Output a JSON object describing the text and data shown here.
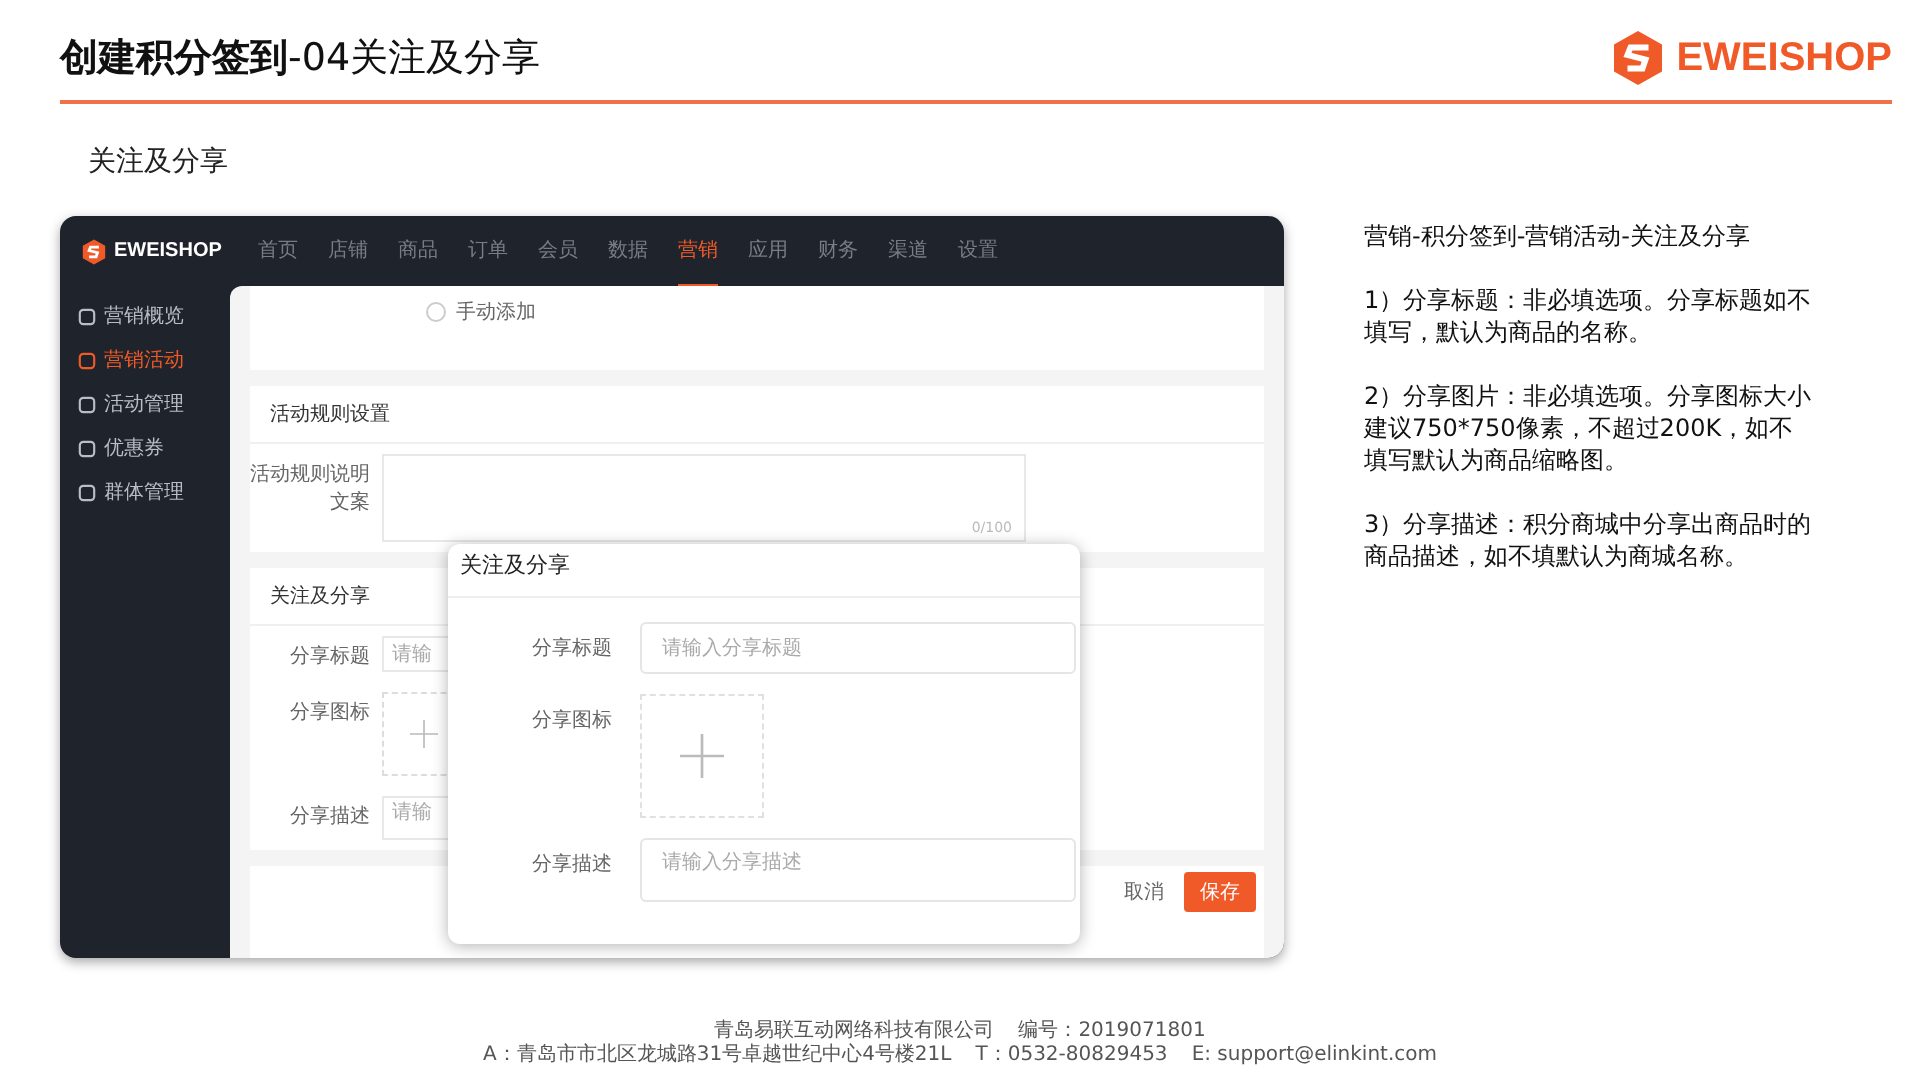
{
  "header": {
    "title": "**创建积分签到**-04关注及分享",
    "logo": "EWEISHOP"
  },
  "section_title": "关注及分享",
  "screenshot": {
    "logo": "EWEISHOP",
    "nav": [
      {
        "label": "首页",
        "selected": false
      },
      {
        "label": "店铺",
        "selected": false
      },
      {
        "label": "商品",
        "selected": false
      },
      {
        "label": "订单",
        "selected": false
      },
      {
        "label": "会员",
        "selected": false
      },
      {
        "label": "数据",
        "selected": false
      },
      {
        "label": "营销",
        "selected": true
      },
      {
        "label": "应用",
        "selected": false
      },
      {
        "label": "财务",
        "selected": false
      },
      {
        "label": "渠道",
        "selected": false
      },
      {
        "label": "设置",
        "selected": false
      }
    ],
    "sidebar": [
      {
        "label": "营销概览",
        "selected": false
      },
      {
        "label": "营销活动",
        "selected": true
      },
      {
        "label": "活动管理",
        "selected": false
      },
      {
        "label": "优惠券",
        "selected": false
      },
      {
        "label": "群体管理",
        "selected": false
      }
    ],
    "radio_option": {
      "label": "手动添加",
      "selected": false
    },
    "rules_card": {
      "title": "活动规则设置",
      "label": "活动规则说明文案",
      "counter": "0/100"
    },
    "share_card": {
      "title": "关注及分享",
      "fields": [
        {
          "label": "分享标题",
          "kind": "input",
          "placeholder": "请输"
        },
        {
          "label": "分享图标",
          "kind": "upload"
        },
        {
          "label": "分享描述",
          "kind": "textarea",
          "placeholder": "请输"
        }
      ]
    },
    "buttons": [
      {
        "label": "取消",
        "kind": "plain"
      },
      {
        "label": "保存",
        "kind": "primary"
      }
    ],
    "modal": {
      "title": "关注及分享",
      "fields": [
        {
          "label": "分享标题",
          "kind": "input",
          "placeholder": "请输入分享标题"
        },
        {
          "label": "分享图标",
          "kind": "upload"
        },
        {
          "label": "分享描述",
          "kind": "textarea",
          "placeholder": "请输入分享描述"
        }
      ]
    }
  },
  "notes": [
    "营销-积分签到-营销活动-关注及分享",
    "1）分享标题：非必填选项。分享标题如不填写，默认为商品的名称。",
    "2）分享图片：非必填选项。分享图标大小建议750*750像素，不超过200K，如不填写默认为商品缩略图。",
    "3）分享描述：积分商城中分享出商品时的商品描述，如不填默认为商城名称。"
  ],
  "footer": {
    "company": "青岛易联互动网络科技有限公司",
    "number": "编号：2019071801",
    "address": "A：青岛市市北区龙城路31号卓越世纪中心4号楼21L",
    "phone": "T：0532-80829453",
    "email": "E: support@elinkint.com"
  }
}
